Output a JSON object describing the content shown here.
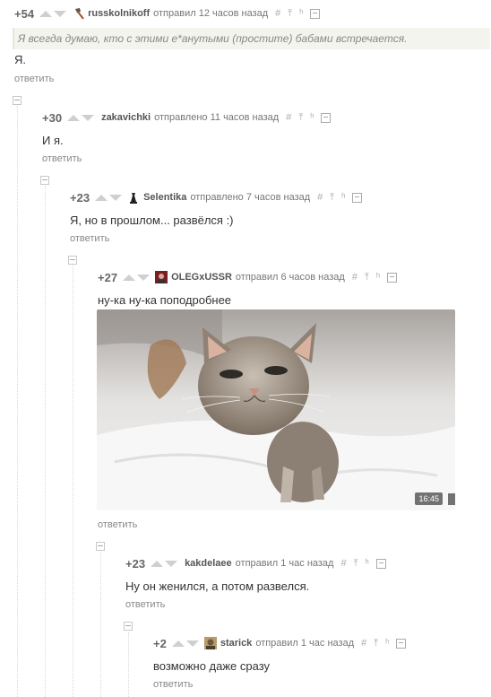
{
  "comments": [
    {
      "rating": "+54",
      "user": "russkolnikoff",
      "time": "отправил 12 часов назад",
      "quote": "Я всегда думаю, кто с этими е*анутыми (простите) бабами встречается.",
      "text": "Я.",
      "reply": "ответить",
      "avatar_icon": "axe-icon"
    },
    {
      "rating": "+30",
      "user": "zakavichki",
      "time": "отправлено 11 часов назад",
      "text": "И я.",
      "reply": "ответить"
    },
    {
      "rating": "+23",
      "user": "Selentika",
      "time": "отправлено 7 часов назад",
      "text": "Я, но в прошлом... развёлся :)",
      "reply": "ответить",
      "avatar_icon": "chess-piece-icon"
    },
    {
      "rating": "+27",
      "user": "OLEGxUSSR",
      "time": "отправил 6 часов назад",
      "text": "ну-ка ну-ка поподробнее",
      "reply": "ответить",
      "image_time": "16:45",
      "avatar_icon": "user-avatar"
    },
    {
      "rating": "+23",
      "user": "kakdelaee",
      "time": "отправил 1 час назад",
      "text": "Ну он женился, а потом развелся.",
      "reply": "ответить"
    },
    {
      "rating": "+2",
      "user": "starick",
      "time": "отправил 1 час назад",
      "text": "возможно даже сразу",
      "reply": "ответить",
      "avatar_icon": "user-avatar"
    }
  ],
  "actions": {
    "link": "#",
    "up": "⤒",
    "branch": "ʰ"
  },
  "colors": {
    "background": "#ffffff",
    "quote_bg": "#f4f4ee",
    "text": "#333333",
    "muted": "#888888"
  }
}
